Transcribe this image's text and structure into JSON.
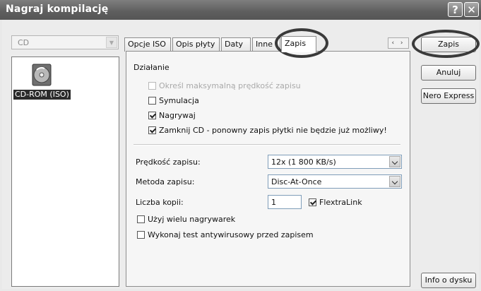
{
  "window": {
    "title": "Nagraj kompilację",
    "help_button": "?",
    "close_button": "✕"
  },
  "left": {
    "disc_type": "CD",
    "compilation_label": "CD-ROM (ISO)"
  },
  "tabs": [
    {
      "label": "Opcje ISO"
    },
    {
      "label": "Opis płyty"
    },
    {
      "label": "Daty"
    },
    {
      "label": "Inne"
    },
    {
      "label": "Zapis",
      "active": true
    }
  ],
  "tab_nav": "‹ ›",
  "action_section": {
    "heading": "Działanie",
    "options": [
      {
        "label": "Określ maksymalną prędkość zapisu",
        "checked": false,
        "disabled": true
      },
      {
        "label": "Symulacja",
        "checked": false,
        "disabled": false
      },
      {
        "label": "Nagrywaj",
        "checked": true,
        "disabled": false
      },
      {
        "label": "Zamknij CD - ponowny zapis płytki nie będzie już możliwy!",
        "checked": true,
        "disabled": false
      }
    ]
  },
  "settings": {
    "speed_label": "Prędkość zapisu:",
    "speed_value": "12x (1 800 KB/s)",
    "method_label": "Metoda zapisu:",
    "method_value": "Disc-At-Once",
    "copies_label": "Liczba kopii:",
    "copies_value": "1",
    "flextralink_label": "FlextraLink",
    "flextralink_checked": true,
    "multi_recorder_label": "Użyj wielu nagrywarek",
    "multi_recorder_checked": false,
    "antivirus_label": "Wykonaj test antywirusowy przed zapisem",
    "antivirus_checked": false
  },
  "buttons": {
    "burn": "Zapis",
    "cancel": "Anuluj",
    "nero_express": "Nero Express",
    "disc_info": "Info o dysku"
  }
}
